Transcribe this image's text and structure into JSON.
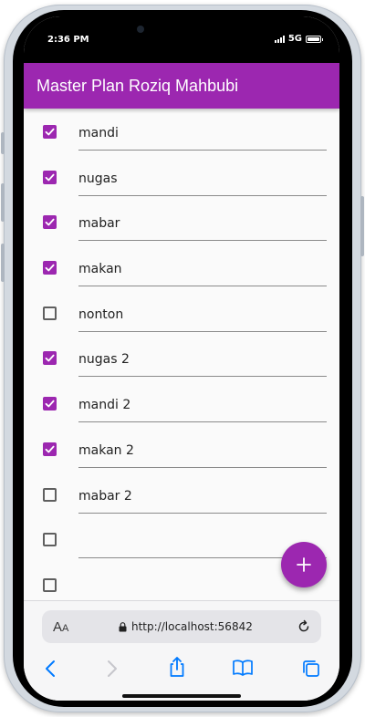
{
  "status_bar": {
    "time": "2:36 PM",
    "network": "5G"
  },
  "app_bar": {
    "title": "Master Plan Roziq Mahbubi"
  },
  "tasks": [
    {
      "label": "mandi",
      "done": true
    },
    {
      "label": "nugas",
      "done": true
    },
    {
      "label": "mabar",
      "done": true
    },
    {
      "label": "makan",
      "done": true
    },
    {
      "label": "nonton",
      "done": false
    },
    {
      "label": "nugas 2",
      "done": true
    },
    {
      "label": "mandi 2",
      "done": true
    },
    {
      "label": "makan 2",
      "done": true
    },
    {
      "label": "mabar 2",
      "done": false
    },
    {
      "label": "",
      "done": false
    },
    {
      "label": "",
      "done": false
    }
  ],
  "fab": {
    "icon": "plus-icon"
  },
  "browser": {
    "aa_label_big": "A",
    "aa_label_small": "A",
    "url": "http://localhost:56842"
  },
  "colors": {
    "primary": "#9c27b0",
    "ios_blue": "#007aff"
  }
}
